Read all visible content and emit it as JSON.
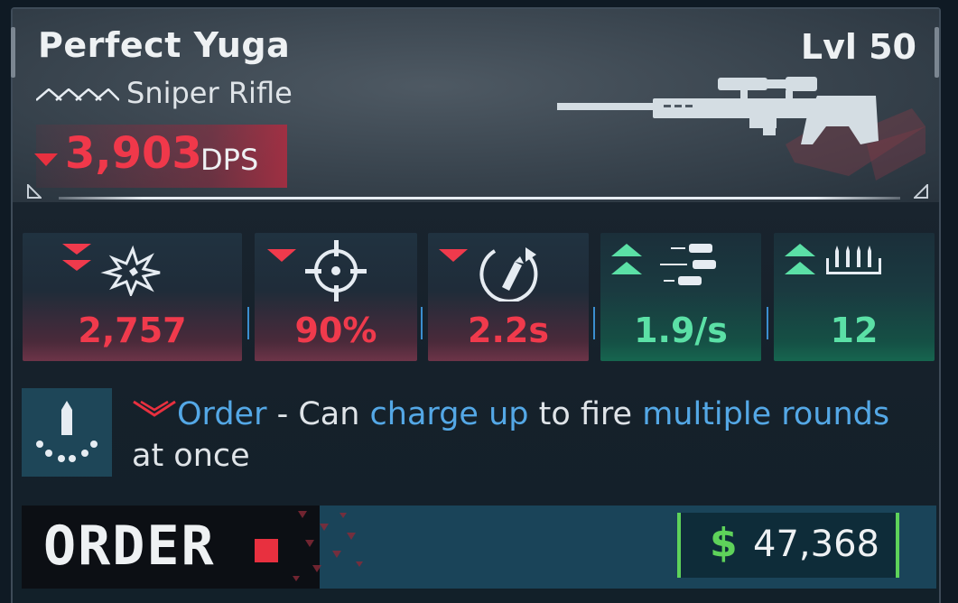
{
  "item": {
    "name": "Perfect Yuga",
    "level": "Lvl 50",
    "weapon_type": "Sniper Rifle",
    "dps_value": "3,903",
    "dps_unit": "DPS"
  },
  "stats": [
    {
      "icon": "damage-burst-icon",
      "value": "2,757",
      "trend": "down",
      "strength": 2
    },
    {
      "icon": "crosshair-accuracy-icon",
      "value": "90%",
      "trend": "down",
      "strength": 1
    },
    {
      "icon": "reload-icon",
      "value": "2.2s",
      "trend": "down",
      "strength": 1
    },
    {
      "icon": "fire-rate-icon",
      "value": "1.9/s",
      "trend": "up",
      "strength": 2
    },
    {
      "icon": "magazine-icon",
      "value": "12",
      "trend": "up",
      "strength": 2
    }
  ],
  "perk": {
    "icon": "charge-shot-icon",
    "name": "Order",
    "separator": " - Can ",
    "highlight1": "charge up",
    "middle": " to fire ",
    "highlight2": "multiple rounds",
    "tail": " at once"
  },
  "manufacturer": {
    "name": "ORDER"
  },
  "price": {
    "symbol": "$",
    "value": "47,368"
  },
  "colors": {
    "negative": "#f03a4c",
    "positive": "#5be0a6",
    "highlight": "#54a8e6",
    "price_accent": "#5ed25a"
  }
}
